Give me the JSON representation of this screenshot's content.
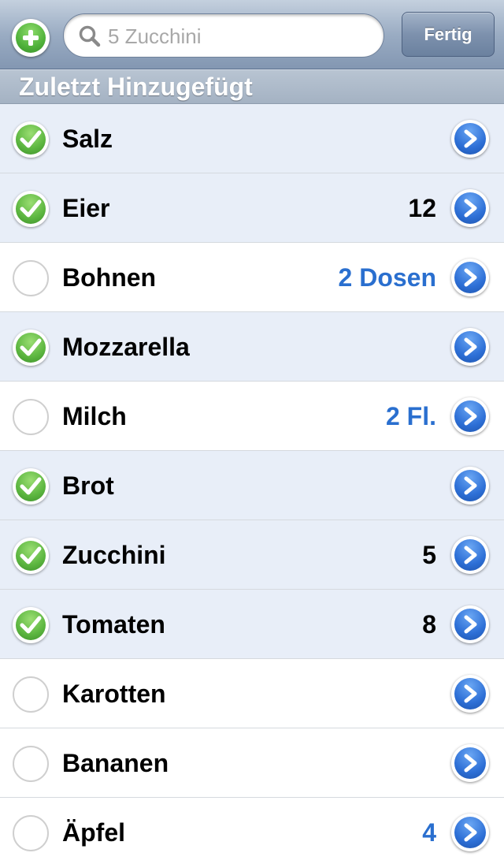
{
  "toolbar": {
    "search_placeholder": "5 Zucchini",
    "done_label": "Fertig"
  },
  "section": {
    "title": "Zuletzt Hinzugefügt"
  },
  "colors": {
    "checked_row": "#e8eef8",
    "quantity_blue": "#2a6fcf",
    "check_green": "#5bb53f",
    "disclosure_blue": "#2d6fd6"
  },
  "items": [
    {
      "name": "Salz",
      "quantity": "",
      "checked": true,
      "qty_style": "plain"
    },
    {
      "name": "Eier",
      "quantity": "12",
      "checked": true,
      "qty_style": "plain"
    },
    {
      "name": "Bohnen",
      "quantity": "2 Dosen",
      "checked": false,
      "qty_style": "blue"
    },
    {
      "name": "Mozzarella",
      "quantity": "",
      "checked": true,
      "qty_style": "plain"
    },
    {
      "name": "Milch",
      "quantity": "2 Fl.",
      "checked": false,
      "qty_style": "blue"
    },
    {
      "name": "Brot",
      "quantity": "",
      "checked": true,
      "qty_style": "plain"
    },
    {
      "name": "Zucchini",
      "quantity": "5",
      "checked": true,
      "qty_style": "plain"
    },
    {
      "name": "Tomaten",
      "quantity": "8",
      "checked": true,
      "qty_style": "plain"
    },
    {
      "name": "Karotten",
      "quantity": "",
      "checked": false,
      "qty_style": "plain"
    },
    {
      "name": "Bananen",
      "quantity": "",
      "checked": false,
      "qty_style": "plain"
    },
    {
      "name": "Äpfel",
      "quantity": "4",
      "checked": false,
      "qty_style": "blue"
    }
  ]
}
